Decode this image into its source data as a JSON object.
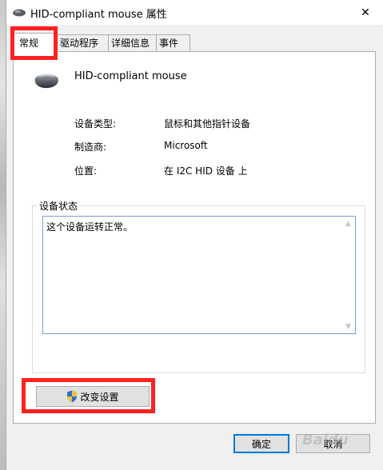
{
  "window": {
    "title": "HID-compliant mouse 属性",
    "close_glyph": "✕"
  },
  "tabs": [
    {
      "label": "常规",
      "active": true
    },
    {
      "label": "驱动程序",
      "active": false
    },
    {
      "label": "详细信息",
      "active": false
    },
    {
      "label": "事件",
      "active": false
    }
  ],
  "device": {
    "name": "HID-compliant mouse",
    "icon": "mouse-icon"
  },
  "properties": [
    {
      "label": "设备类型:",
      "value": "鼠标和其他指针设备"
    },
    {
      "label": "制造商:",
      "value": "Microsoft"
    },
    {
      "label": "位置:",
      "value": "在 I2C HID 设备 上"
    }
  ],
  "status": {
    "legend": "设备状态",
    "text": "这个设备运转正常。"
  },
  "buttons": {
    "change_settings": "改变设置",
    "ok": "确定",
    "cancel": "取消"
  },
  "colors": {
    "highlight": "#ff2121",
    "focus_border": "#0078d7"
  },
  "icons": {
    "shield": "uac-shield-icon",
    "close": "close-icon"
  }
}
